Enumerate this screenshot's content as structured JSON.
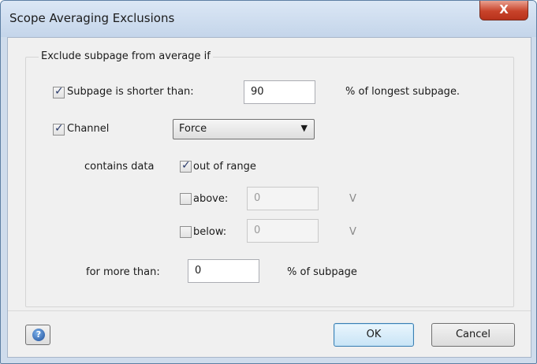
{
  "window": {
    "title": "Scope Averaging Exclusions",
    "close_glyph": "X"
  },
  "group": {
    "legend": "Exclude subpage from average if"
  },
  "subpage_shorter": {
    "checked": true,
    "label": "Subpage is shorter than:",
    "value": "90",
    "suffix": "% of longest subpage."
  },
  "channel": {
    "checked": true,
    "label": "Channel",
    "selected": "Force"
  },
  "contains_data": {
    "label": "contains data",
    "out_of_range": {
      "checked": true,
      "label": "out of range"
    },
    "above": {
      "checked": false,
      "label": "above:",
      "value": "0",
      "unit": "V"
    },
    "below": {
      "checked": false,
      "label": "below:",
      "value": "0",
      "unit": "V"
    }
  },
  "for_more_than": {
    "label": "for more than:",
    "value": "0",
    "suffix": "% of subpage"
  },
  "buttons": {
    "ok": "OK",
    "cancel": "Cancel",
    "help_glyph": "?"
  },
  "icons": {
    "close": "close-icon",
    "help": "help-icon",
    "dropdown": "chevron-down-icon",
    "check": "check-icon"
  }
}
